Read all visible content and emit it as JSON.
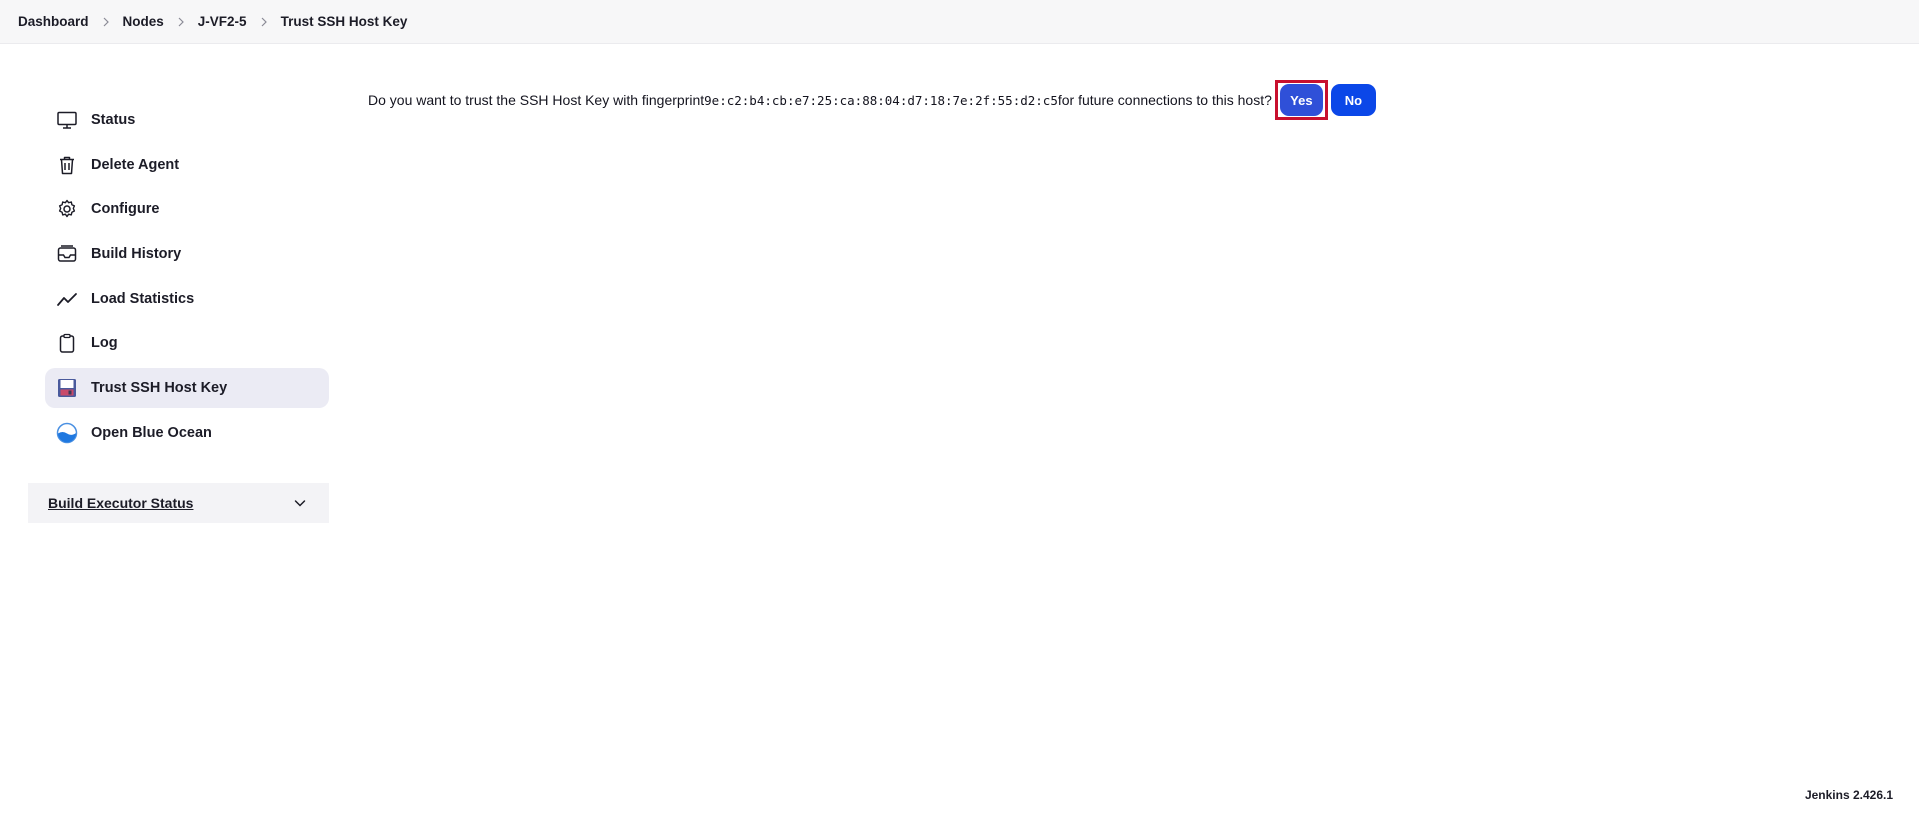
{
  "breadcrumb": {
    "items": [
      "Dashboard",
      "Nodes",
      "J-VF2-5",
      "Trust SSH Host Key"
    ]
  },
  "sidebar": {
    "items": [
      {
        "label": "Status",
        "icon": "monitor-icon"
      },
      {
        "label": "Delete Agent",
        "icon": "trash-icon"
      },
      {
        "label": "Configure",
        "icon": "gear-icon"
      },
      {
        "label": "Build History",
        "icon": "inbox-icon"
      },
      {
        "label": "Load Statistics",
        "icon": "trend-line-icon"
      },
      {
        "label": "Log",
        "icon": "clipboard-icon"
      },
      {
        "label": "Trust SSH Host Key",
        "icon": "floppy-disk-icon",
        "active": true
      },
      {
        "label": "Open Blue Ocean",
        "icon": "blue-ocean-icon"
      }
    ]
  },
  "executor": {
    "title": "Build Executor Status"
  },
  "prompt": {
    "before": "Do you want to trust the SSH Host Key with fingerprint ",
    "fingerprint": "9e:c2:b4:cb:e7:25:ca:88:04:d7:18:7e:2f:55:d2:c5",
    "after": " for future connections to this host?",
    "yes_label": "Yes",
    "no_label": "No"
  },
  "footer": {
    "version": "Jenkins 2.426.1"
  },
  "colors": {
    "accent": "#0b47e8",
    "highlight_border": "#c8102e",
    "active_item_bg": "#ebebf4"
  }
}
